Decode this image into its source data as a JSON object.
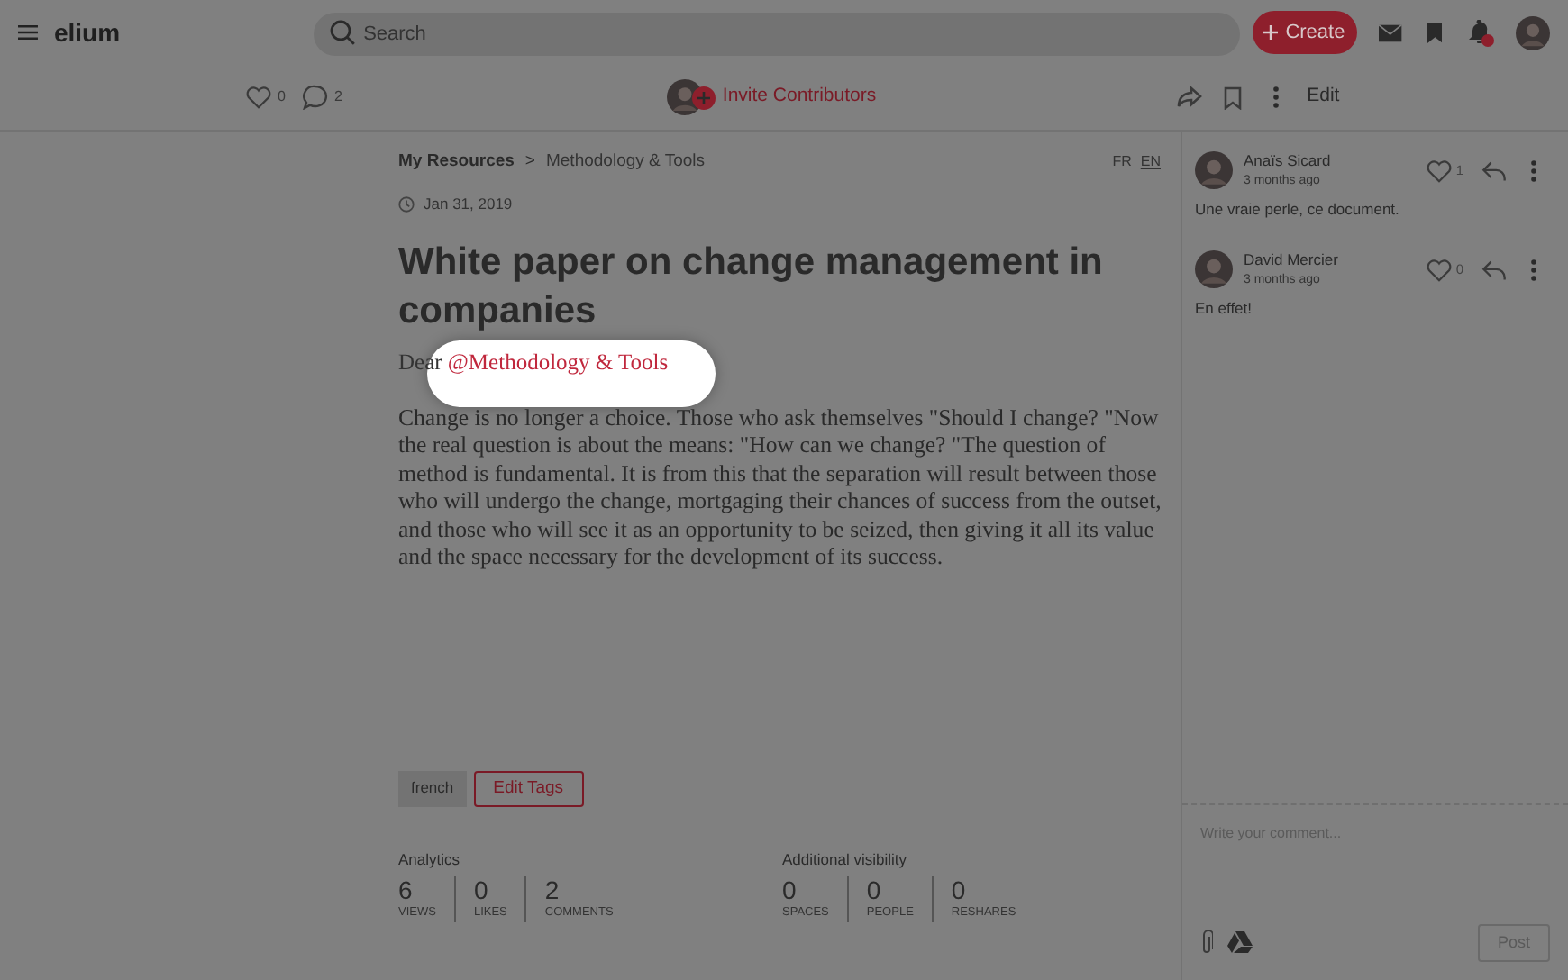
{
  "app": {
    "name": "elium"
  },
  "search": {
    "placeholder": "Search"
  },
  "create_button": {
    "label": "Create"
  },
  "notifications": {
    "unread": true
  },
  "toolbar": {
    "likes": "0",
    "comments": "2",
    "invite": "Invite Contributors",
    "edit": "Edit"
  },
  "breadcrumb": {
    "items": [
      "My Resources",
      "Methodology & Tools"
    ],
    "separator": ">"
  },
  "languages": [
    {
      "label": "FR",
      "selected": false
    },
    {
      "label": "EN",
      "selected": true
    }
  ],
  "date": "Jan 31, 2019",
  "title": "White paper on change management in companies",
  "greeting": "Dear",
  "mention": "@Methodology & Tools",
  "body": "Change is no longer a choice. Those who ask themselves \"Should I change? \"Now the real question is about the means: \"How can we change? \"The question of method is fundamental. It is from this that the separation will result between those who will undergo the change, mortgaging their chances of success from the outset, and those who will see it as an opportunity to be seized, then giving it all its value and the space necessary for the development of its success.",
  "tags": [
    "french"
  ],
  "edit_tags": "Edit Tags",
  "analytics": {
    "title": "Analytics",
    "stats": [
      {
        "value": "6",
        "label": "VIEWS"
      },
      {
        "value": "0",
        "label": "LIKES"
      },
      {
        "value": "2",
        "label": "COMMENTS"
      }
    ]
  },
  "visibility": {
    "title": "Additional visibility",
    "stats": [
      {
        "value": "0",
        "label": "SPACES"
      },
      {
        "value": "0",
        "label": "PEOPLE"
      },
      {
        "value": "0",
        "label": "RESHARES"
      }
    ]
  },
  "comments": [
    {
      "author": "Anaïs Sicard",
      "time": "3 months ago",
      "likes": "1",
      "text": "Une vraie perle, ce document."
    },
    {
      "author": "David Mercier",
      "time": "3 months ago",
      "likes": "0",
      "text": "En effet!"
    }
  ],
  "comment_box": {
    "placeholder": "Write your comment...",
    "button": "Post"
  }
}
